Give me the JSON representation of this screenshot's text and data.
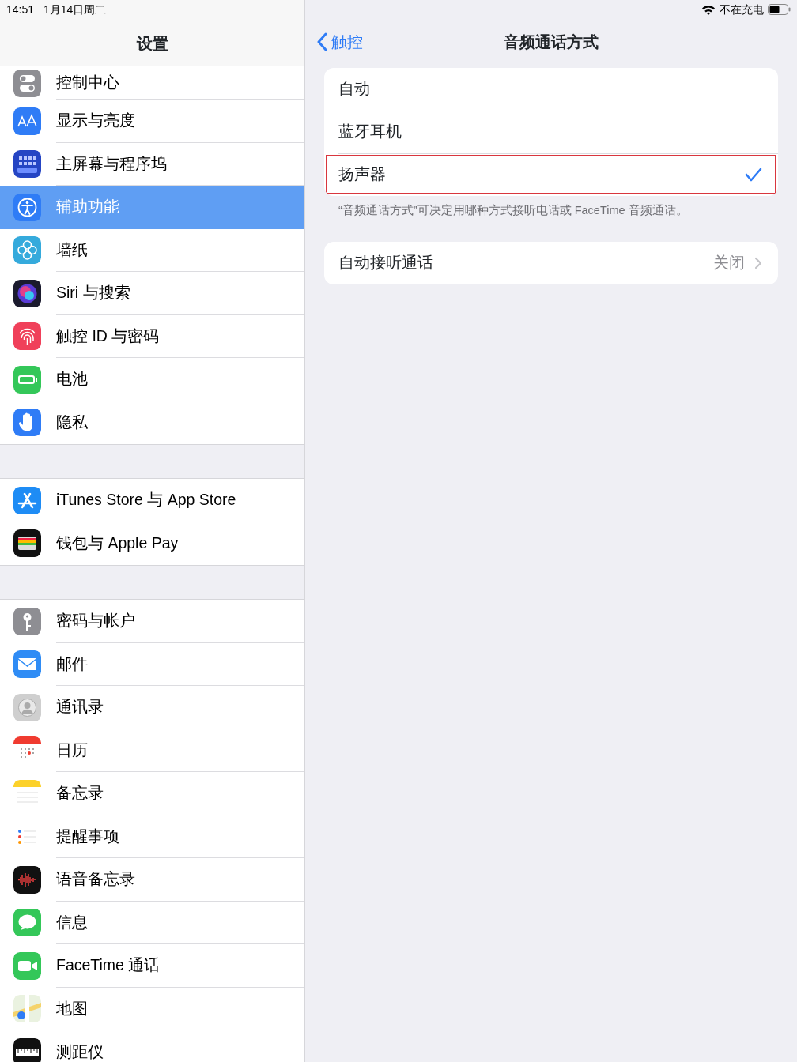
{
  "status_bar": {
    "time": "14:51",
    "date": "1月14日周二",
    "charging": "不在充电"
  },
  "sidebar": {
    "title": "设置",
    "groups": [
      {
        "items": [
          {
            "label": "控制中心",
            "selected": false
          },
          {
            "label": "显示与亮度",
            "selected": false
          },
          {
            "label": "主屏幕与程序坞",
            "selected": false
          },
          {
            "label": "辅助功能",
            "selected": true
          },
          {
            "label": "墙纸",
            "selected": false
          },
          {
            "label": "Siri 与搜索",
            "selected": false
          },
          {
            "label": "触控 ID 与密码",
            "selected": false
          },
          {
            "label": "电池",
            "selected": false
          },
          {
            "label": "隐私",
            "selected": false
          }
        ]
      },
      {
        "items": [
          {
            "label": "iTunes Store 与 App Store",
            "selected": false
          },
          {
            "label": "钱包与 Apple Pay",
            "selected": false
          }
        ]
      },
      {
        "items": [
          {
            "label": "密码与帐户",
            "selected": false
          },
          {
            "label": "邮件",
            "selected": false
          },
          {
            "label": "通讯录",
            "selected": false
          },
          {
            "label": "日历",
            "selected": false
          },
          {
            "label": "备忘录",
            "selected": false
          },
          {
            "label": "提醒事项",
            "selected": false
          },
          {
            "label": "语音备忘录",
            "selected": false
          },
          {
            "label": "信息",
            "selected": false
          },
          {
            "label": "FaceTime 通话",
            "selected": false
          },
          {
            "label": "地图",
            "selected": false
          },
          {
            "label": "测距仪",
            "selected": false
          }
        ]
      }
    ]
  },
  "detail": {
    "back": "触控",
    "title": "音频通话方式",
    "options": [
      {
        "label": "自动",
        "selected": false,
        "highlighted": false
      },
      {
        "label": "蓝牙耳机",
        "selected": false,
        "highlighted": false
      },
      {
        "label": "扬声器",
        "selected": true,
        "highlighted": true
      }
    ],
    "footnote": "“音频通话方式”可决定用哪种方式接听电话或 FaceTime 音频通话。",
    "auto_answer": {
      "label": "自动接听通话",
      "value": "关闭"
    }
  }
}
